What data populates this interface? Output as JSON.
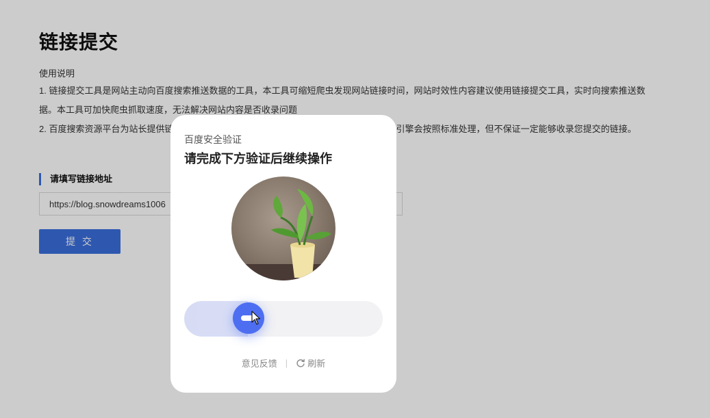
{
  "page": {
    "title": "链接提交",
    "usage": {
      "heading": "使用说明",
      "line1": "1. 链接提交工具是网站主动向百度搜索推送数据的工具，本工具可缩短爬虫发现网站链接时间，网站时效性内容建议使用链接提交工具，实时向搜索推送数",
      "line1b": "据。本工具可加快爬虫抓取速度，无法解决网站内容是否收录问题",
      "line2": "2. 百度搜索资源平台为站长提供链接提交通道，您可以提交想被百度收录的链接，百度搜索引擎会按照标准处理，但不保证一定能够收录您提交的链接。"
    },
    "form": {
      "section_label": "请填写链接地址",
      "url_value": "https://blog.snowdreams1006",
      "submit_label": "提 交"
    }
  },
  "captcha": {
    "subtitle": "百度安全验证",
    "title": "请完成下方验证后继续操作",
    "image_icon": "potted-plant-image",
    "slider_progress": 0.32,
    "handle_icon": "arrow-right-icon",
    "feedback_label": "意见反馈",
    "separator": "|",
    "refresh_label": "刷新",
    "refresh_icon": "refresh-icon",
    "accent_color": "#4e6ef2"
  },
  "colors": {
    "primary": "#3a6fdc",
    "overlay": "rgba(0,0,0,0.2)"
  }
}
